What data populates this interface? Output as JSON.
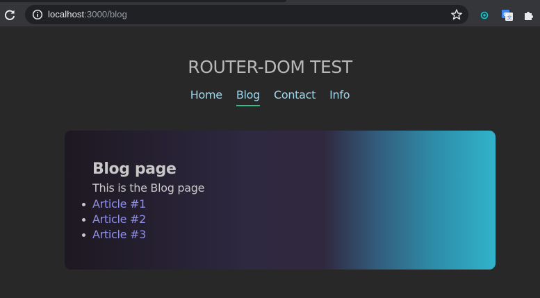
{
  "browser": {
    "url_host": "localhost",
    "url_rest": ":3000/blog",
    "icons": [
      "reload-icon",
      "site-info-icon",
      "bookmark-star-icon",
      "extension-circle-icon",
      "google-translate-icon",
      "extensions-puzzle-icon"
    ]
  },
  "site": {
    "title": "ROUTER-DOM TEST",
    "nav": [
      {
        "label": "Home",
        "active": false
      },
      {
        "label": "Blog",
        "active": true
      },
      {
        "label": "Contact",
        "active": false
      },
      {
        "label": "Info",
        "active": false
      }
    ],
    "colors": {
      "background": "#282828",
      "nav_link": "#9ed6ea",
      "active_underline": "#2fbf8f",
      "article_link": "#8f8fe8"
    }
  },
  "blog": {
    "heading": "Blog page",
    "description": "This is the Blog page",
    "articles": [
      "Article #1",
      "Article #2",
      "Article #3"
    ]
  }
}
